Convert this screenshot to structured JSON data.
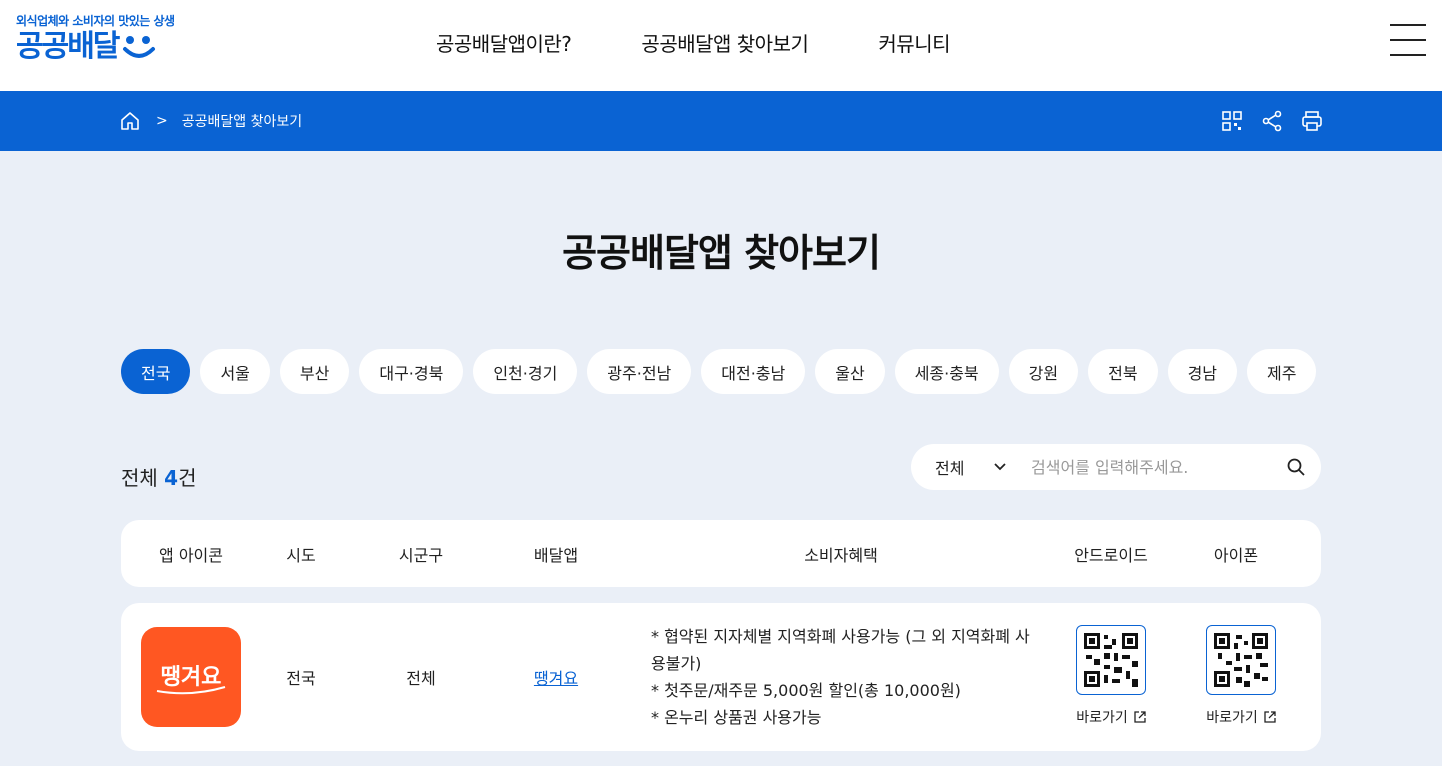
{
  "header": {
    "tagline": "외식업체와 소비자의 맛있는 상생",
    "logo_text": "공공배달",
    "nav": [
      {
        "label": "공공배달앱이란?"
      },
      {
        "label": "공공배달앱 찾아보기"
      },
      {
        "label": "커뮤니티"
      }
    ]
  },
  "breadcrumb": {
    "current": "공공배달앱 찾아보기"
  },
  "page_title": "공공배달앱 찾아보기",
  "regions": [
    {
      "label": "전국",
      "active": true
    },
    {
      "label": "서울"
    },
    {
      "label": "부산"
    },
    {
      "label": "대구·경북"
    },
    {
      "label": "인천·경기"
    },
    {
      "label": "광주·전남"
    },
    {
      "label": "대전·충남"
    },
    {
      "label": "울산"
    },
    {
      "label": "세종·충북"
    },
    {
      "label": "강원"
    },
    {
      "label": "전북"
    },
    {
      "label": "경남"
    },
    {
      "label": "제주"
    }
  ],
  "count": {
    "prefix": "전체 ",
    "number": "4",
    "suffix": "건"
  },
  "search": {
    "select_value": "전체",
    "placeholder": "검색어를 입력해주세요."
  },
  "table": {
    "headers": [
      "앱 아이콘",
      "시도",
      "시군구",
      "배달앱",
      "소비자혜택",
      "안드로이드",
      "아이폰"
    ],
    "rows": [
      {
        "icon_text": "땡겨요",
        "sido": "전국",
        "sigungu": "전체",
        "app": "땡겨요",
        "benefits": [
          "* 협약된 지자체별 지역화폐 사용가능 (그 외 지역화폐 사용불가)",
          "* 첫주문/재주문 5,000원 할인(총 10,000원)",
          "* 온누리 상품권 사용가능"
        ],
        "android_link": "바로가기",
        "ios_link": "바로가기"
      }
    ]
  },
  "colors": {
    "brand": "#0a63d3",
    "app_icon_bg": "#ff5722",
    "page_bg": "#eaeff7"
  }
}
